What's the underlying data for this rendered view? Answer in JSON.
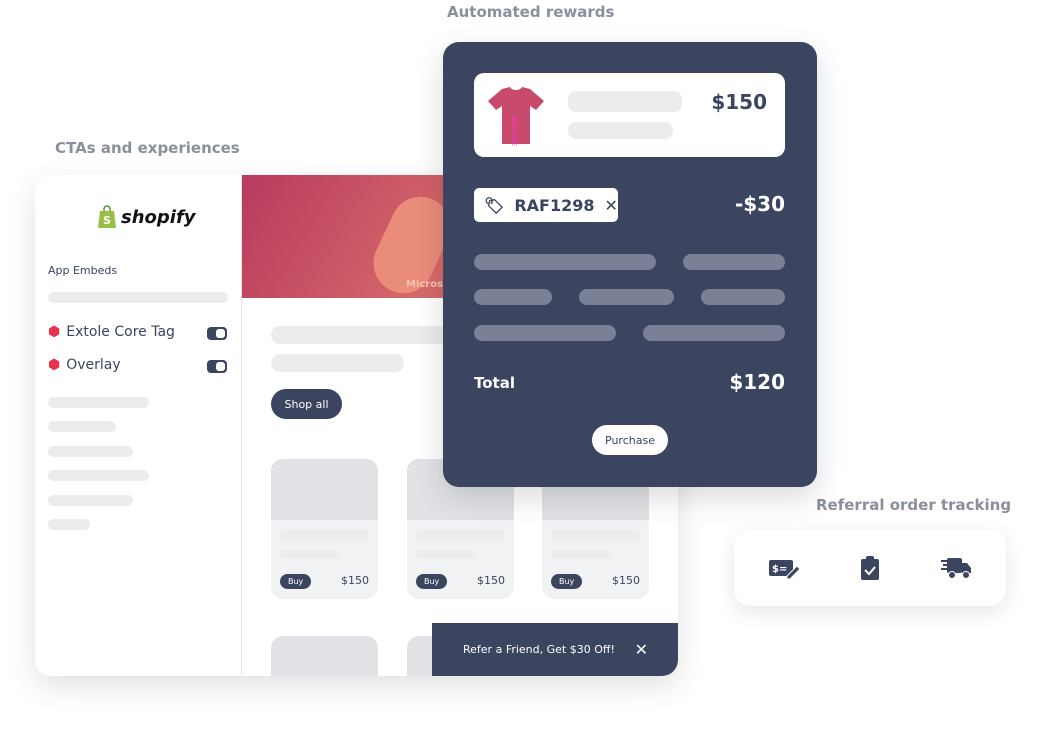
{
  "labels": {
    "rewards": "Automated rewards",
    "ctas": "CTAs and experiences",
    "tracking": "Referral order tracking"
  },
  "shopify": {
    "logo": "shopify",
    "section": "App Embeds",
    "embeds": [
      {
        "label": "Extole Core Tag",
        "enabled": true
      },
      {
        "label": "Overlay",
        "enabled": true
      }
    ],
    "hero_caption": "Microsi",
    "shop_all": "Shop all",
    "products": [
      {
        "buy": "Buy",
        "price": "$150"
      },
      {
        "buy": "Buy",
        "price": "$150"
      },
      {
        "buy": "Buy",
        "price": "$150"
      }
    ],
    "banner": "Refer a Friend, Get $30 Off!"
  },
  "checkout": {
    "price": "$150",
    "coupon": "RAF1298",
    "discount": "-$30",
    "total_label": "Total",
    "total": "$120",
    "purchase": "Purchase"
  },
  "tracking_icons": [
    "check-payment-icon",
    "clipboard-check-icon",
    "fast-truck-icon"
  ],
  "colors": {
    "navy": "#3b4560",
    "brand_red": "#e8334e",
    "shopify_green": "#95bf47"
  }
}
